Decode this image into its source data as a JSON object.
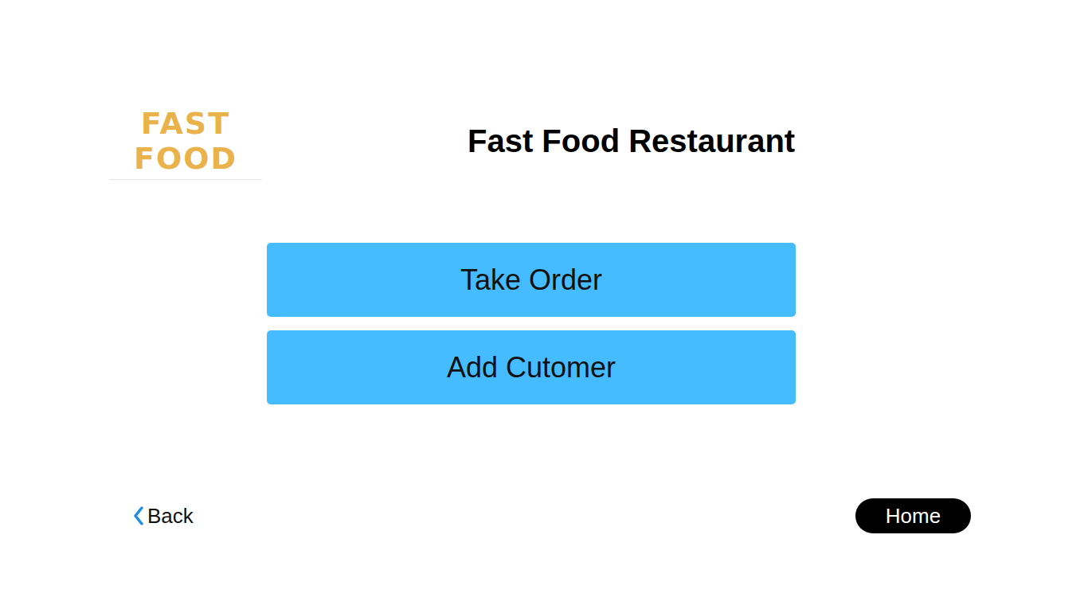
{
  "window": {
    "title": "Fast Food Restaurant"
  },
  "logo": {
    "lines": [
      "FAST",
      "FOOD"
    ]
  },
  "actions": [
    {
      "label": "Take Order"
    },
    {
      "label": "Add Cutomer"
    }
  ],
  "nav": {
    "back": "Back",
    "home": "Home"
  }
}
